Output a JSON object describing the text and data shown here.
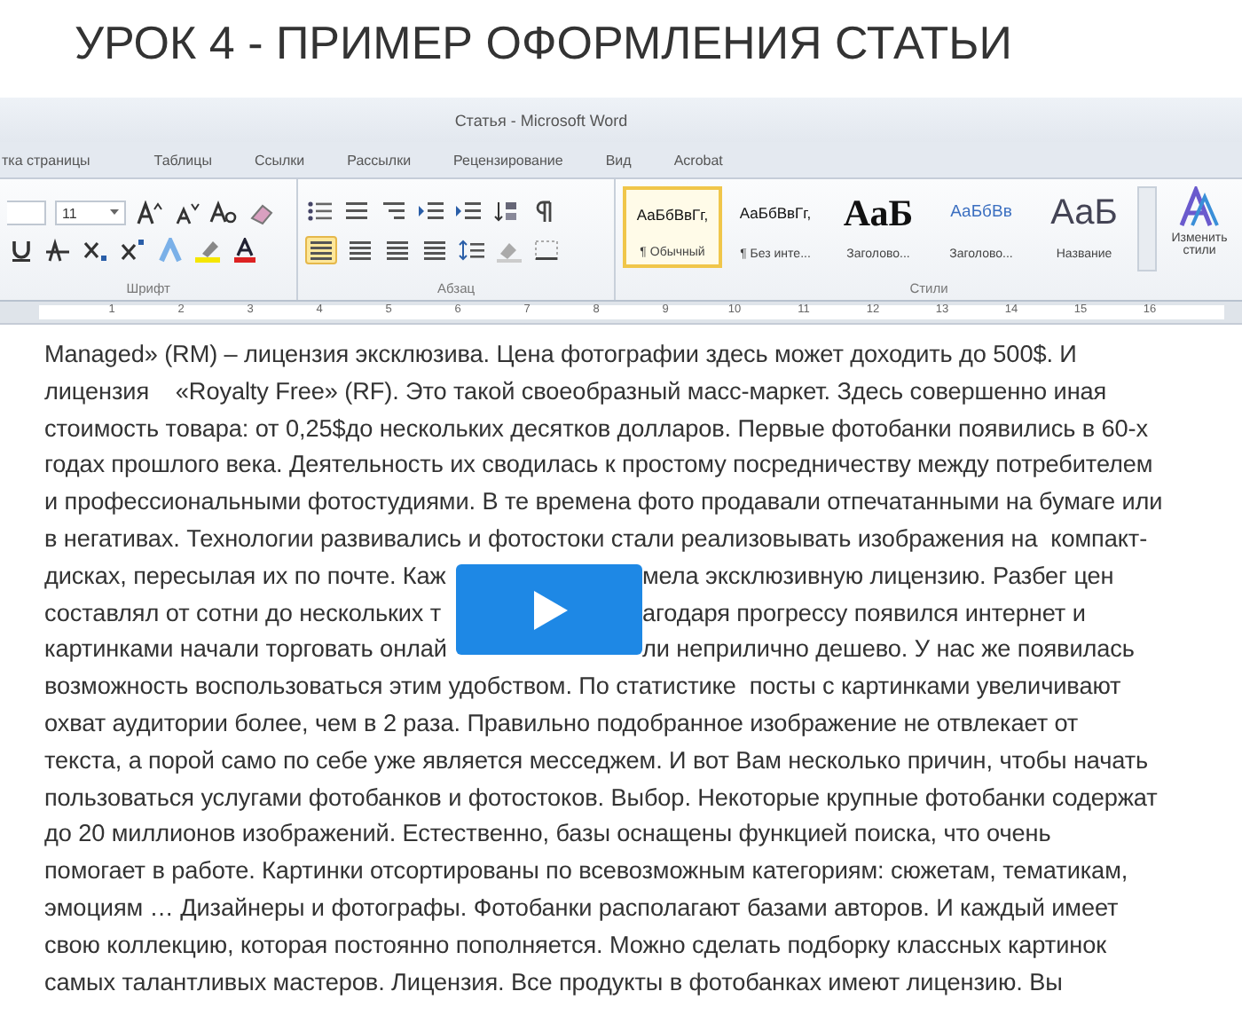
{
  "page": {
    "title": "УРОК 4 - ПРИМЕР ОФОРМЛЕНИЯ СТАТЬИ"
  },
  "video": {
    "window_title": "Статья - Microsoft Word",
    "ribbon_tabs": [
      {
        "label": "тка страницы",
        "selected": false
      },
      {
        "label": "Таблицы",
        "selected": false
      },
      {
        "label": "Ссылки",
        "selected": false
      },
      {
        "label": "Рассылки",
        "selected": false
      },
      {
        "label": "Рецензирование",
        "selected": false
      },
      {
        "label": "Вид",
        "selected": false
      },
      {
        "label": "Acrobat",
        "selected": false
      }
    ],
    "font_size": "11",
    "groups": [
      "Шрифт",
      "Абзац",
      "Стили"
    ],
    "styles": [
      {
        "kind": "normal",
        "sample": "АаБбВвГг,",
        "name": "¶ Обычный",
        "selected": true
      },
      {
        "kind": "normal",
        "sample": "АаБбВвГг,",
        "name": "¶ Без инте...",
        "selected": false
      },
      {
        "kind": "heading1",
        "sample": "АаБ",
        "name": "Заголово...",
        "selected": false
      },
      {
        "kind": "heading2",
        "sample": "АаБбВв",
        "name": "Заголово...",
        "selected": false
      },
      {
        "kind": "title",
        "sample": "АаБ",
        "name": "Название",
        "selected": false
      }
    ],
    "change_styles": "Изменить стили",
    "ruler_numbers": [
      "1",
      "2",
      "3",
      "4",
      "5",
      "6",
      "7",
      "8",
      "9",
      "10",
      "11",
      "12",
      "13",
      "14",
      "15",
      "16"
    ],
    "lines": [
      {
        "parts": [
          "Managed» (RM) – лицензия эксклюзива. Цена фотографии здесь может доходить до 500$. И"
        ]
      },
      {
        "parts": [
          "лицензия    «Royalty Free» (RF). Это такой своеобразный масс-маркет. Здесь совершенно иная"
        ]
      },
      {
        "parts": [
          "стоимость товара: от 0,25$до нескольких десятков долларов. Первые фотобанки появились в 60-х"
        ]
      },
      {
        "parts": [
          "годах прошлого века. Деятельность их сводилась к простому посредничеству между потребителем"
        ]
      },
      {
        "parts": [
          "и профессиональными фотостудиями. В те времена фото продавали отпечатанными на бумаге или"
        ]
      },
      {
        "parts": [
          "в негативах. Технологии развивались и фотостоки стали реализовывать изображения на  компакт-"
        ]
      },
      {
        "parts": [
          "дисках, пересылая их по почте. Каж",
          "мела эксклюзивную лицензию. Разбег цен"
        ]
      },
      {
        "parts": [
          "составлял от сотни до нескольких т",
          "агодаря прогрессу появился интернет и"
        ]
      },
      {
        "parts": [
          "картинками начали торговать онлай",
          "ли неприлично дешево. У нас же появилась"
        ]
      },
      {
        "parts": [
          "возможность воспользоваться этим удобством. По статистике  посты с картинками увеличивают"
        ]
      },
      {
        "parts": [
          "охват аудитории более, чем в 2 раза. Правильно подобранное изображение не отвлекает от"
        ]
      },
      {
        "parts": [
          "текста, а порой само по себе уже является месседжем. И вот Вам несколько причин, чтобы начать"
        ]
      },
      {
        "parts": [
          "пользоваться услугами фотобанков и фотостоков. Выбор. Некоторые крупные фотобанки содержат"
        ]
      },
      {
        "parts": [
          "до 20 миллионов изображений. Естественно, базы оснащены функцией поиска, что очень"
        ]
      },
      {
        "parts": [
          "помогает в работе. Картинки отсортированы по всевозможным категориям: сюжетам, тематикам,"
        ]
      },
      {
        "parts": [
          "эмоциям … Дизайнеры и фотографы. Фотобанки располагают базами авторов. И каждый имеет"
        ]
      },
      {
        "parts": [
          "свою коллекцию, которая постоянно пополняется. Можно сделать подборку классных картинок"
        ]
      },
      {
        "parts": [
          "самых талантливых мастеров. Лицензия. Все продукты в фотобанках имеют лицензию. Вы"
        ]
      }
    ]
  }
}
